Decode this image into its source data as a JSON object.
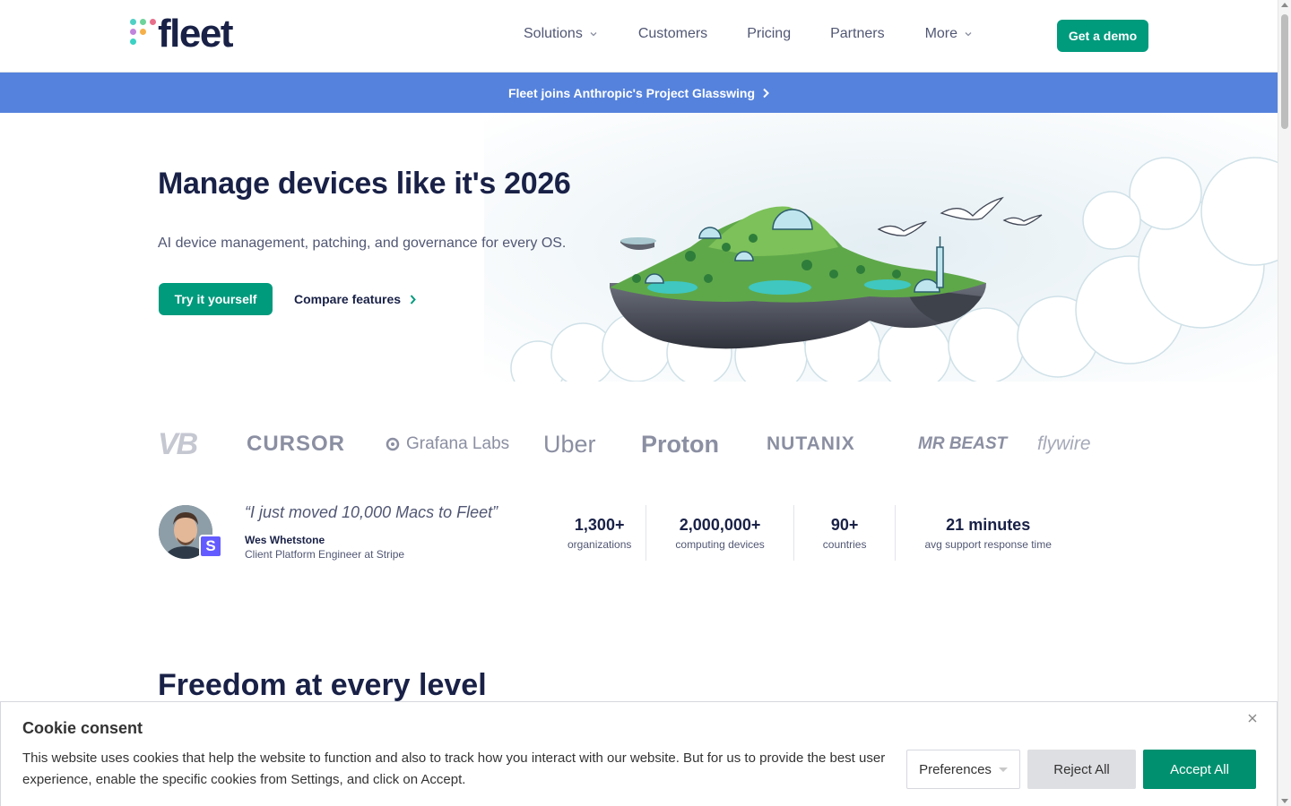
{
  "header": {
    "logo_text": "fleet",
    "nav": [
      {
        "label": "Solutions",
        "has_dropdown": true
      },
      {
        "label": "Customers",
        "has_dropdown": false
      },
      {
        "label": "Pricing",
        "has_dropdown": false
      },
      {
        "label": "Partners",
        "has_dropdown": false
      },
      {
        "label": "More",
        "has_dropdown": true
      }
    ],
    "cta_label": "Get a demo"
  },
  "banner": {
    "text": "Fleet joins Anthropic's Project Glasswing"
  },
  "hero": {
    "title": "Manage devices like it's 2026",
    "subtitle": "AI device management, patching, and governance for every OS.",
    "primary_cta": "Try it yourself",
    "secondary_cta": "Compare features"
  },
  "customer_logos": [
    "VB",
    "CURSOR",
    "Grafana Labs",
    "Uber",
    "Proton",
    "NUTANIX",
    "MR BEAST",
    "flywire"
  ],
  "testimonial": {
    "quote": "“I just moved 10,000 Macs to Fleet”",
    "name": "Wes Whetstone",
    "role": "Client Platform Engineer at Stripe",
    "badge": "S"
  },
  "stats": [
    {
      "value": "1,300+",
      "label": "organizations"
    },
    {
      "value": "2,000,000+",
      "label": "computing devices"
    },
    {
      "value": "90+",
      "label": "countries"
    },
    {
      "value": "21 minutes",
      "label": "avg support response time"
    }
  ],
  "section": {
    "title": "Freedom at every level"
  },
  "cookie": {
    "title": "Cookie consent",
    "text": "This website uses cookies that help the website to function and also to track how you interact with our website. But for us to provide the best user experience, enable the specific cookies from Settings, and click on Accept.",
    "preferences_label": "Preferences",
    "reject_label": "Reject All",
    "accept_label": "Accept All"
  },
  "colors": {
    "brand_green": "#009a7d",
    "banner_blue": "#5582dc",
    "navy": "#192147",
    "accept_green": "#00906f"
  },
  "icons": {
    "nav_dropdown": "chevron-down-icon",
    "banner_arrow": "chevron-right-icon",
    "cookie_close": "close-icon"
  }
}
